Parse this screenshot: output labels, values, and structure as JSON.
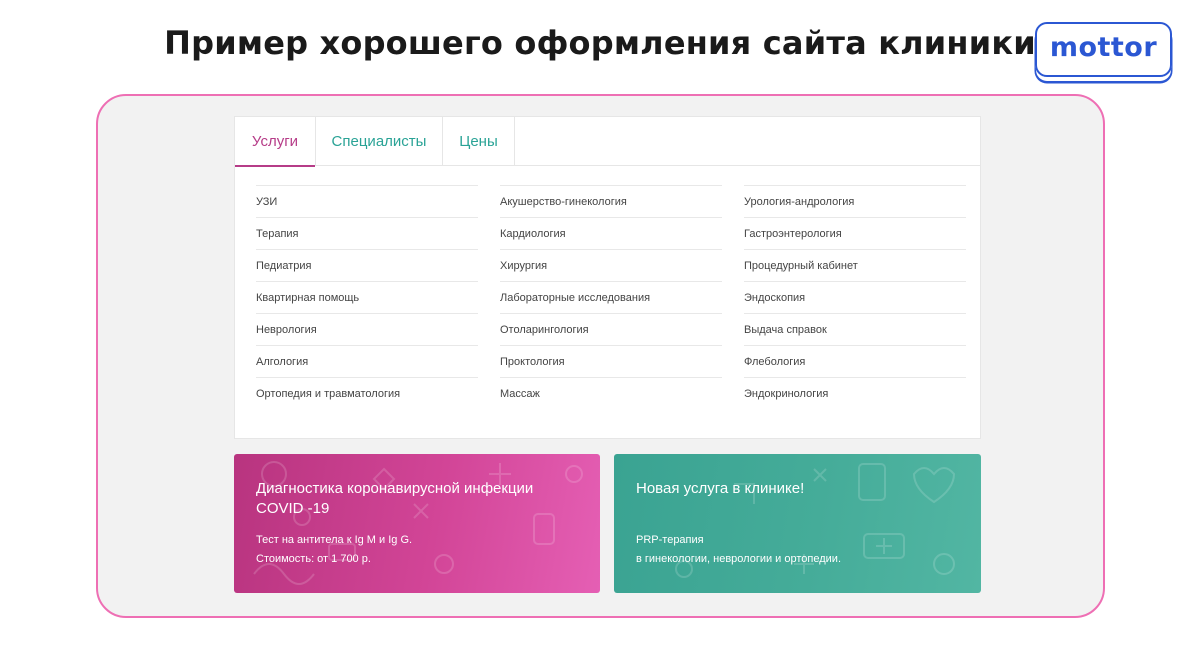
{
  "header": {
    "title": "Пример хорошего оформления сайта клиники",
    "logo_text": "mottor"
  },
  "tabs": [
    {
      "label": "Услуги",
      "active": true
    },
    {
      "label": "Специалисты",
      "active": false
    },
    {
      "label": "Цены",
      "active": false
    }
  ],
  "services": {
    "columns": [
      [
        "УЗИ",
        "Терапия",
        "Педиатрия",
        "Квартирная помощь",
        "Неврология",
        "Алгология",
        "Ортопедия и травматология"
      ],
      [
        "Акушерство-гинекология",
        "Кардиология",
        "Хирургия",
        "Лабораторные исследования",
        "Отоларингология",
        "Проктология",
        "Массаж"
      ],
      [
        "Урология-андрология",
        "Гастроэнтерология",
        "Процедурный кабинет",
        "Эндоскопия",
        "Выдача справок",
        "Флебология",
        "Эндокринология"
      ]
    ]
  },
  "promos": {
    "covid": {
      "title_line1": "Диагностика коронавирусной инфекции",
      "title_line2": "COVID -19",
      "line1": "Тест на антитела к Ig M и Ig G.",
      "line2": "Стоимость: от 1 700 р."
    },
    "new_service": {
      "title": "Новая услуга в клинике!",
      "line1": "PRP-терапия",
      "line2": "в гинекологии, неврологии и ортопедии."
    }
  },
  "colors": {
    "accent_pink": "#b63c88",
    "accent_teal": "#2aa396",
    "frame_border": "#ee6fb4",
    "logo_blue": "#2b57d3"
  }
}
